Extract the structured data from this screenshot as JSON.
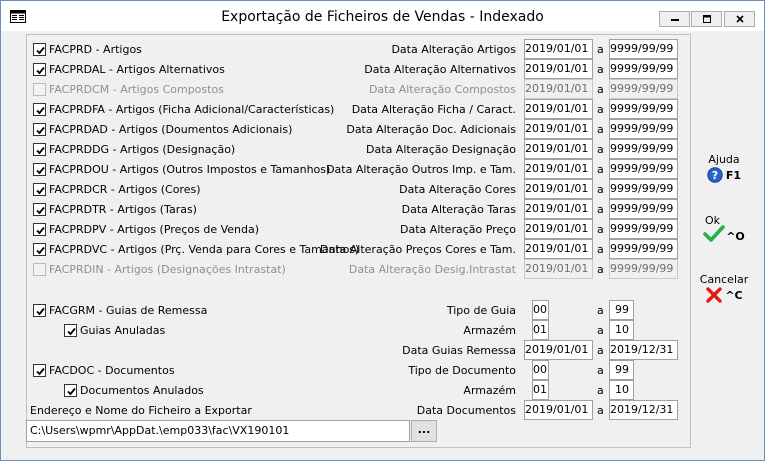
{
  "window": {
    "title": "Exportação de Ficheiros de Vendas - Indexado",
    "controls": {
      "minimize": "minimize-icon",
      "restore": "restore-icon",
      "close": "close-icon"
    }
  },
  "sep": "a",
  "rows": [
    {
      "label": "FACPRD - Artigos",
      "checked": true,
      "enabled": true,
      "range_label": "Data Alteração Artigos",
      "from": "2019/01/01",
      "to": "9999/99/99"
    },
    {
      "label": "FACPRDAL - Artigos Alternativos",
      "checked": true,
      "enabled": true,
      "range_label": "Data Alteração Alternativos",
      "from": "2019/01/01",
      "to": "9999/99/99"
    },
    {
      "label": "FACPRDCM - Artigos Compostos",
      "checked": false,
      "enabled": false,
      "range_label": "Data Alteração Compostos",
      "from": "2019/01/01",
      "to": "9999/99/99"
    },
    {
      "label": "FACPRDFA - Artigos (Ficha Adicional/Características)",
      "checked": true,
      "enabled": true,
      "range_label": "Data Alteração Ficha / Caract.",
      "from": "2019/01/01",
      "to": "9999/99/99"
    },
    {
      "label": "FACPRDAD - Artigos (Doumentos Adicionais)",
      "checked": true,
      "enabled": true,
      "range_label": "Data Alteração Doc. Adicionais",
      "from": "2019/01/01",
      "to": "9999/99/99"
    },
    {
      "label": "FACPRDDG - Artigos (Designação)",
      "checked": true,
      "enabled": true,
      "range_label": "Data Alteração Designação",
      "from": "2019/01/01",
      "to": "9999/99/99"
    },
    {
      "label": "FACPRDOU - Artigos (Outros Impostos e Tamanhos)",
      "checked": true,
      "enabled": true,
      "range_label": "Data Alteração Outros Imp. e Tam.",
      "from": "2019/01/01",
      "to": "9999/99/99"
    },
    {
      "label": "FACPRDCR - Artigos (Cores)",
      "checked": true,
      "enabled": true,
      "range_label": "Data Alteração Cores",
      "from": "2019/01/01",
      "to": "9999/99/99"
    },
    {
      "label": "FACPRDTR - Artigos (Taras)",
      "checked": true,
      "enabled": true,
      "range_label": "Data Alteração Taras",
      "from": "2019/01/01",
      "to": "9999/99/99"
    },
    {
      "label": "FACPRDPV - Artigos (Preços de Venda)",
      "checked": true,
      "enabled": true,
      "range_label": "Data Alteração Preço",
      "from": "2019/01/01",
      "to": "9999/99/99"
    },
    {
      "label": "FACPRDVC - Artigos (Prç. Venda para Cores e Tamanhos)",
      "checked": true,
      "enabled": true,
      "range_label": "Data Alteração Preços Cores e Tam.",
      "from": "2019/01/01",
      "to": "9999/99/99"
    },
    {
      "label": "FACPRDIN - Artigos (Designações Intrastat)",
      "checked": false,
      "enabled": false,
      "range_label": "Data Alteração Desig.Intrastat",
      "from": "2019/01/01",
      "to": "9999/99/99"
    }
  ],
  "guias": {
    "label": "FACGRM - Guias de Remessa",
    "checked": true,
    "anuladas_label": "Guias Anuladas",
    "anuladas_checked": true,
    "tipo_label": "Tipo de Guia",
    "tipo_from": "00",
    "tipo_to": "99",
    "armazem_label": "Armazém",
    "armazem_from": "01",
    "armazem_to": "10",
    "data_label": "Data Guias Remessa",
    "data_from": "2019/01/01",
    "data_to": "2019/12/31"
  },
  "docs": {
    "label": "FACDOC - Documentos",
    "checked": true,
    "anulados_label": "Documentos Anulados",
    "anulados_checked": true,
    "tipo_label": "Tipo de Documento",
    "tipo_from": "00",
    "tipo_to": "99",
    "armazem_label": "Armazém",
    "armazem_from": "01",
    "armazem_to": "10",
    "data_label": "Data Documentos",
    "data_from": "2019/01/01",
    "data_to": "2019/12/31"
  },
  "file": {
    "label": "Endereço e Nome do Ficheiro a Exportar",
    "path": "C:\\Users\\wpmr\\AppDat.\\emp033\\fac\\VX190101",
    "browse": "..."
  },
  "side": {
    "help_label": "Ajuda",
    "help_key": "F1",
    "ok_label": "Ok",
    "ok_key": "^O",
    "cancel_label": "Cancelar",
    "cancel_key": "^C"
  },
  "colors": {
    "ok": "#22b14c",
    "cancel": "#e01a1a",
    "help": "#2a62c9"
  }
}
